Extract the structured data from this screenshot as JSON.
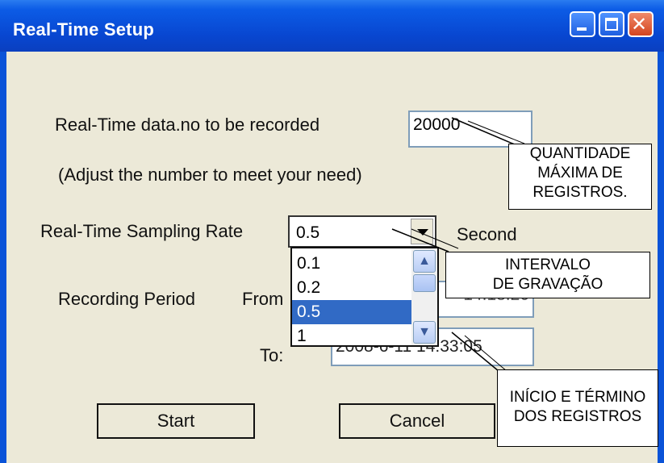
{
  "window": {
    "title": "Real-Time Setup"
  },
  "form": {
    "records_label": "Real-Time data.no to be recorded",
    "records_value": "20000",
    "records_hint": "(Adjust the number to meet your need)",
    "rate_label": "Real-Time Sampling Rate",
    "rate_value": "0.5",
    "rate_unit": "Second",
    "rate_options": [
      "0.1",
      "0.2",
      "0.5",
      "1"
    ],
    "period_label": "Recording Period",
    "from_label": "From",
    "from_value_visible_tail": "14:18:20",
    "to_label": "To:",
    "to_value": "2008-6-11 14:33:05"
  },
  "buttons": {
    "start": "Start",
    "cancel": "Cancel"
  },
  "callouts": {
    "records_line1": "QUANTIDADE",
    "records_line2": "MÁXIMA DE",
    "records_line3": "REGISTROS.",
    "rate_line1": "INTERVALO",
    "rate_line2": "DE GRAVAÇÃO",
    "period_line1": "INÍCIO E TÉRMINO",
    "period_line2": "DOS REGISTROS"
  }
}
